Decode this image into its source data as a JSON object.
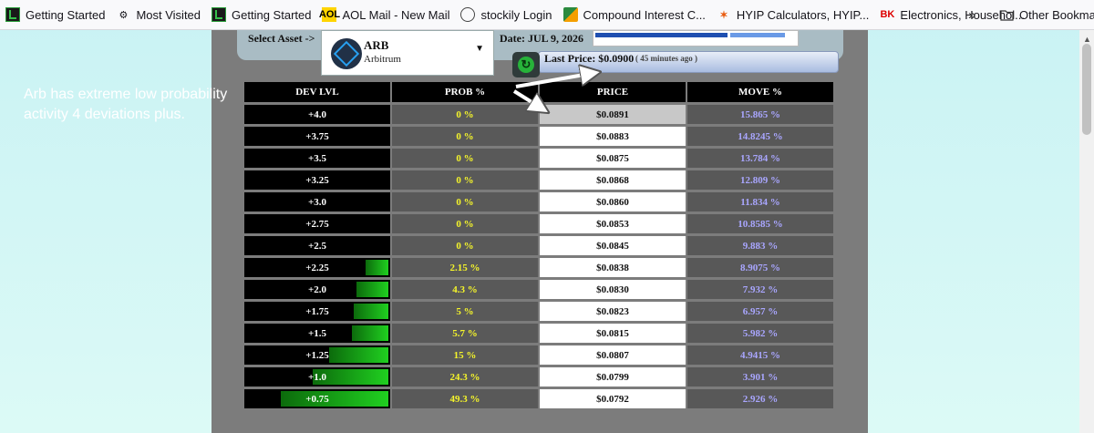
{
  "bookmarks": [
    {
      "label": "Getting Started",
      "icon": "getting-started-icon"
    },
    {
      "label": "Most Visited",
      "icon": "gear-icon"
    },
    {
      "label": "Getting Started",
      "icon": "getting-started-icon"
    },
    {
      "label": "AOL Mail - New Mail",
      "icon": "aol-icon"
    },
    {
      "label": "stockily Login",
      "icon": "globe-icon"
    },
    {
      "label": "Compound Interest C...",
      "icon": "compound-icon"
    },
    {
      "label": "HYIP Calculators, HYIP...",
      "icon": "hyip-icon"
    },
    {
      "label": "Electronics, Househol...",
      "icon": "bk-icon"
    }
  ],
  "bookmarks_more": "»",
  "other_bookmarks": "Other Bookmarks",
  "header": {
    "select_label": "Select Asset ->",
    "asset_symbol": "ARB",
    "asset_name": "Arbitrum",
    "date": "Date: JUL 9, 2026",
    "last_price": "Last Price: $0.0900",
    "last_updated": "( 45 minutes ago )"
  },
  "annotation": "Arb has extreme low probability activity 4 deviations plus.",
  "table": {
    "headers": [
      "DEV LVL",
      "PROB %",
      "PRICE",
      "MOVE %"
    ],
    "rows": [
      {
        "dev": "+4.0",
        "prob": "0 %",
        "price": "$0.0891",
        "move": "15.865 %",
        "bar": 0
      },
      {
        "dev": "+3.75",
        "prob": "0 %",
        "price": "$0.0883",
        "move": "14.8245 %",
        "bar": 0
      },
      {
        "dev": "+3.5",
        "prob": "0 %",
        "price": "$0.0875",
        "move": "13.784 %",
        "bar": 0
      },
      {
        "dev": "+3.25",
        "prob": "0 %",
        "price": "$0.0868",
        "move": "12.809 %",
        "bar": 0
      },
      {
        "dev": "+3.0",
        "prob": "0 %",
        "price": "$0.0860",
        "move": "11.834 %",
        "bar": 0
      },
      {
        "dev": "+2.75",
        "prob": "0 %",
        "price": "$0.0853",
        "move": "10.8585 %",
        "bar": 0
      },
      {
        "dev": "+2.5",
        "prob": "0 %",
        "price": "$0.0845",
        "move": "9.883 %",
        "bar": 0
      },
      {
        "dev": "+2.25",
        "prob": "2.15 %",
        "price": "$0.0838",
        "move": "8.9075 %",
        "bar": 2.15
      },
      {
        "dev": "+2.0",
        "prob": "4.3 %",
        "price": "$0.0830",
        "move": "7.932 %",
        "bar": 4.3
      },
      {
        "dev": "+1.75",
        "prob": "5 %",
        "price": "$0.0823",
        "move": "6.957 %",
        "bar": 5
      },
      {
        "dev": "+1.5",
        "prob": "5.7 %",
        "price": "$0.0815",
        "move": "5.982 %",
        "bar": 5.7
      },
      {
        "dev": "+1.25",
        "prob": "15 %",
        "price": "$0.0807",
        "move": "4.9415 %",
        "bar": 15
      },
      {
        "dev": "+1.0",
        "prob": "24.3 %",
        "price": "$0.0799",
        "move": "3.901 %",
        "bar": 24.3
      },
      {
        "dev": "+0.75",
        "prob": "49.3 %",
        "price": "$0.0792",
        "move": "2.926 %",
        "bar": 49.3
      }
    ]
  },
  "colors": {
    "prob_text": "#f5f52a",
    "move_text": "#a9a6ff",
    "bar_green": "#20d020"
  }
}
